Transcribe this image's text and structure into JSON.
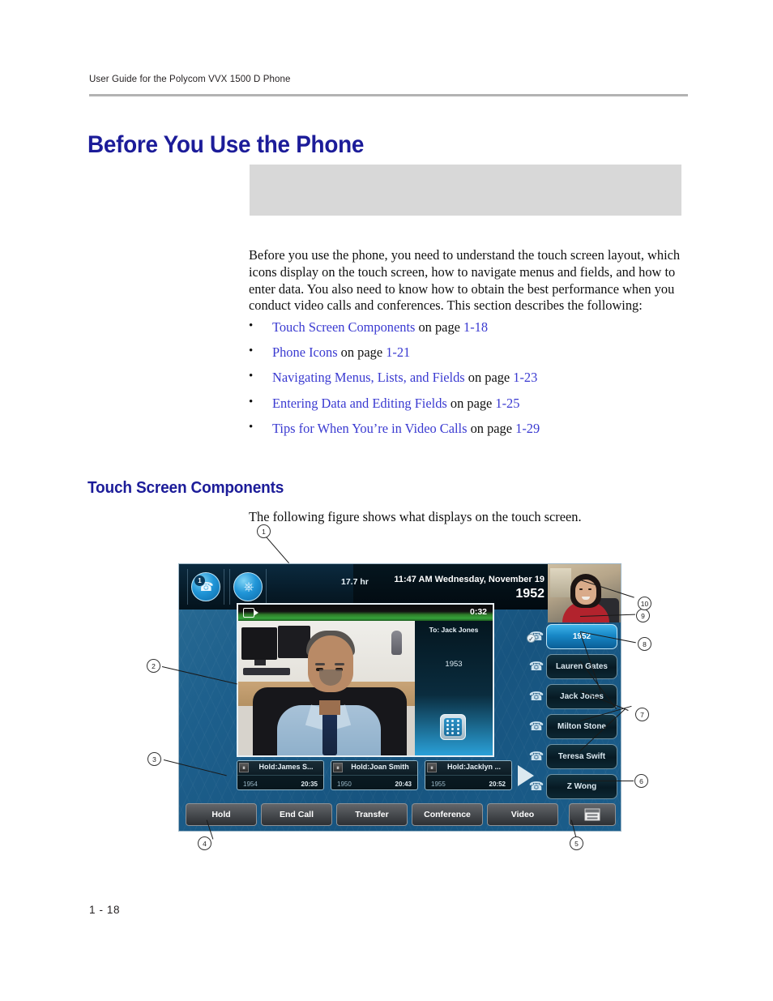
{
  "header": {
    "running_head": "User Guide for the Polycom VVX 1500 D Phone"
  },
  "chapter_title": "Before You Use the Phone",
  "intro_paragraph": "Before you use the phone, you need to understand the touch screen layout, which icons display on the touch screen, how to navigate menus and fields, and how to enter data. You also need to know how to obtain the best performance when you conduct video calls and conferences. This section describes the following:",
  "bullets": [
    {
      "bullet": "•",
      "link": "Touch Screen Components",
      "mid": " on page ",
      "page": "1-18"
    },
    {
      "bullet": "•",
      "link": "Phone Icons",
      "mid": " on page ",
      "page": "1-21"
    },
    {
      "bullet": "•",
      "link": "Navigating Menus, Lists, and Fields",
      "mid": " on page ",
      "page": "1-23"
    },
    {
      "bullet": "•",
      "link": "Entering Data and Editing Fields",
      "mid": " on page ",
      "page": "1-25"
    },
    {
      "bullet": "•",
      "link": "Tips for When You’re in Video Calls",
      "mid": " on page ",
      "page": "1-29"
    }
  ],
  "section_title": "Touch Screen Components",
  "figure_intro": "The following figure shows what displays on the touch screen.",
  "folio": "1 - 18",
  "figure": {
    "callouts": [
      "1",
      "2",
      "3",
      "4",
      "5",
      "6",
      "7",
      "8",
      "9",
      "10"
    ],
    "status_bar": {
      "line_badge": "1",
      "handset_icon": "handset-icon",
      "usb_icon": "usb-icon",
      "battery": "17.7 hr",
      "datetime": "11:47 AM  Wednesday, November 19",
      "extension": "1952"
    },
    "video_window": {
      "camera_icon": "camera-icon",
      "duration": "0:32",
      "far_party_label": "To: Jack Jones",
      "far_party_number": "1953",
      "keypad_icon": "keypad-icon"
    },
    "contacts": [
      {
        "label": "1952",
        "active": true,
        "icon": "handset-icon",
        "check": "✓"
      },
      {
        "label": "Lauren Gates",
        "active": false,
        "icon": "handset-icon",
        "check": ""
      },
      {
        "label": "Jack Jones",
        "active": false,
        "icon": "handset-icon",
        "check": ""
      },
      {
        "label": "Milton Stone",
        "active": false,
        "icon": "handset-icon",
        "check": ""
      },
      {
        "label": "Teresa Swift",
        "active": false,
        "icon": "handset-icon",
        "check": ""
      },
      {
        "label": "Z Wong",
        "active": false,
        "icon": "handset-icon",
        "check": ""
      }
    ],
    "held_calls": [
      {
        "title": "Hold:James S...",
        "number": "1954",
        "duration": "20:35"
      },
      {
        "title": "Hold:Joan Smith",
        "number": "1950",
        "duration": "20:43"
      },
      {
        "title": "Hold:Jacklyn ...",
        "number": "1955",
        "duration": "20:52"
      }
    ],
    "soft_keys": [
      {
        "label": "Hold",
        "icon": ""
      },
      {
        "label": "End Call",
        "icon": ""
      },
      {
        "label": "Transfer",
        "icon": ""
      },
      {
        "label": "Conference",
        "icon": ""
      },
      {
        "label": "Video",
        "icon": ""
      },
      {
        "label": "",
        "icon": "menu-icon"
      }
    ],
    "colors": {
      "link": "#3a3ad1",
      "heading": "#1c1c99",
      "gray_box": "#d8d8d8",
      "screen_blue": "#1d5f8c",
      "active_key": "#1787c6"
    }
  }
}
